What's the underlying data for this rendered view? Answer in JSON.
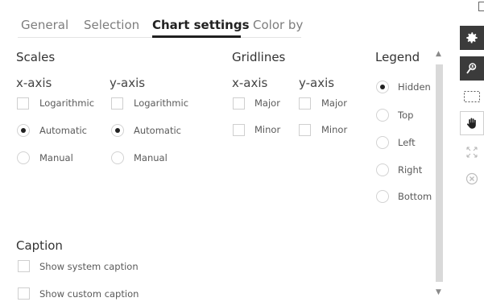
{
  "tabs": [
    {
      "label": "General"
    },
    {
      "label": "Selection"
    },
    {
      "label": "Chart settings"
    },
    {
      "label": "Color by"
    }
  ],
  "scales": {
    "title": "Scales",
    "x_axis": {
      "title": "x-axis",
      "log_label": "Logarithmic",
      "auto_label": "Automatic",
      "manual_label": "Manual",
      "selected": "Automatic"
    },
    "y_axis": {
      "title": "y-axis",
      "log_label": "Logarithmic",
      "auto_label": "Automatic",
      "manual_label": "Manual",
      "selected": "Automatic"
    }
  },
  "gridlines": {
    "title": "Gridlines",
    "x_axis": {
      "title": "x-axis",
      "major_label": "Major",
      "minor_label": "Minor"
    },
    "y_axis": {
      "title": "y-axis",
      "major_label": "Major",
      "minor_label": "Minor"
    }
  },
  "legend": {
    "title": "Legend",
    "options": [
      "Hidden",
      "Top",
      "Left",
      "Right",
      "Bottom"
    ],
    "selected": "Hidden"
  },
  "caption": {
    "title": "Caption",
    "system_label": "Show system caption",
    "custom_label": "Show custom caption"
  },
  "toolbar_icons": [
    "settings-gear-icon",
    "search-person-icon",
    "marquee-select-icon",
    "hand-pan-icon",
    "expand-icon",
    "close-circle-icon"
  ]
}
